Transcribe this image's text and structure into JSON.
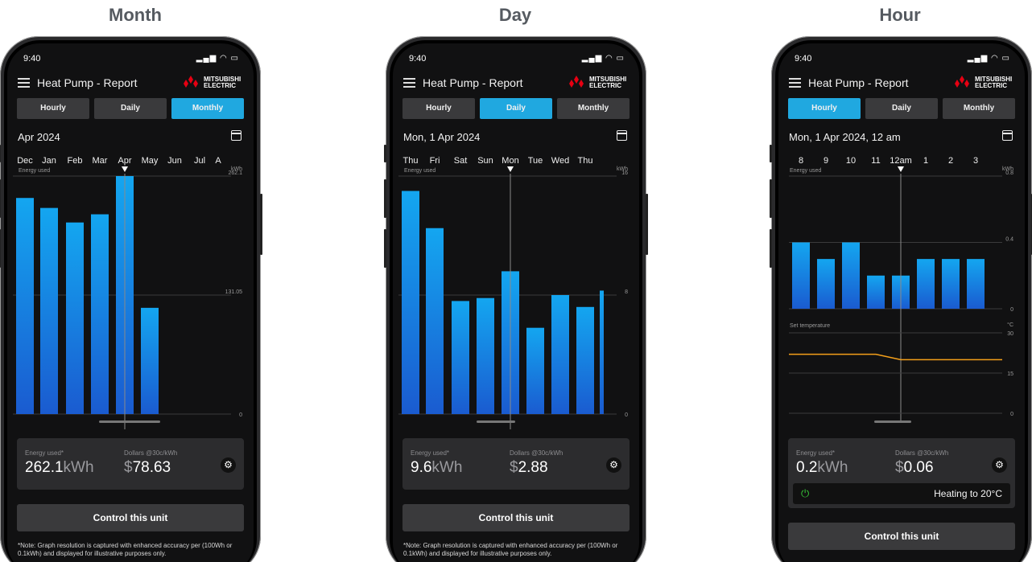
{
  "panels": [
    {
      "heading": "Month",
      "status_time": "9:40",
      "app_title": "Heat Pump - Report",
      "brand": "MITSUBISHI\nELECTRIC",
      "tabs": [
        "Hourly",
        "Daily",
        "Monthly"
      ],
      "active_tab": "Monthly",
      "date": "Apr 2024",
      "axis_labels": [
        "Dec",
        "Jan",
        "Feb",
        "Mar",
        "Apr",
        "May",
        "Jun",
        "Jul",
        "A"
      ],
      "chart_label": "Energy used",
      "chart_unit": "kWh",
      "summary": {
        "energy_label": "Energy used*",
        "energy_value": "262.1",
        "energy_unit": "kWh",
        "dollars_label": "Dollars @30c/kWh",
        "dollar_sign": "$",
        "dollars_value": "78.63"
      },
      "control_label": "Control this unit",
      "note": "*Note: Graph resolution is captured with enhanced accuracy per (100Wh or 0.1kWh) and displayed for illustrative purposes only."
    },
    {
      "heading": "Day",
      "status_time": "9:40",
      "app_title": "Heat Pump - Report",
      "brand": "MITSUBISHI\nELECTRIC",
      "tabs": [
        "Hourly",
        "Daily",
        "Monthly"
      ],
      "active_tab": "Daily",
      "date": "Mon, 1 Apr 2024",
      "axis_labels": [
        "Thu",
        "Fri",
        "Sat",
        "Sun",
        "Mon",
        "Tue",
        "Wed",
        "Thu"
      ],
      "chart_label": "Energy used",
      "chart_unit": "kWh",
      "summary": {
        "energy_label": "Energy used*",
        "energy_value": "9.6",
        "energy_unit": "kWh",
        "dollars_label": "Dollars @30c/kWh",
        "dollar_sign": "$",
        "dollars_value": "2.88"
      },
      "control_label": "Control this unit",
      "note": "*Note: Graph resolution is captured with enhanced accuracy per (100Wh or 0.1kWh) and displayed for illustrative purposes only."
    },
    {
      "heading": "Hour",
      "status_time": "9:40",
      "app_title": "Heat Pump - Report",
      "brand": "MITSUBISHI\nELECTRIC",
      "tabs": [
        "Hourly",
        "Daily",
        "Monthly"
      ],
      "active_tab": "Hourly",
      "date": "Mon, 1 Apr 2024, 12 am",
      "axis_labels": [
        "8",
        "9",
        "10",
        "11",
        "12am",
        "1",
        "2",
        "3"
      ],
      "chart_label": "Energy used",
      "chart_unit": "kWh",
      "temp_label": "Set temperature",
      "temp_unit": "°C",
      "summary": {
        "energy_label": "Energy used*",
        "energy_value": "0.2",
        "energy_unit": "kWh",
        "dollars_label": "Dollars @30c/kWh",
        "dollar_sign": "$",
        "dollars_value": "0.06"
      },
      "heating_text": "Heating to 20°C",
      "control_label": "Control this unit"
    }
  ],
  "chart_data": [
    {
      "type": "bar",
      "categories": [
        "Dec",
        "Jan",
        "Feb",
        "Mar",
        "Apr",
        "May",
        "Jun",
        "Jul"
      ],
      "values": [
        238,
        227,
        211,
        220,
        262.1,
        117,
        0,
        0
      ],
      "ylabel": "kWh",
      "ylim": [
        0,
        262.1
      ],
      "yticks": [
        0,
        131.05,
        262.1
      ],
      "selected": "Apr",
      "color": "#1aa0e8"
    },
    {
      "type": "bar",
      "categories": [
        "Thu",
        "Fri",
        "Sat",
        "Sun",
        "Mon",
        "Tue",
        "Wed",
        "Thu"
      ],
      "values": [
        15.0,
        12.5,
        7.6,
        7.8,
        9.6,
        5.8,
        8.0,
        7.2
      ],
      "ylabel": "kWh",
      "ylim": [
        0,
        16
      ],
      "yticks": [
        0,
        8,
        16
      ],
      "selected": "Mon",
      "color": "#1aa0e8"
    },
    {
      "type": "bar",
      "categories": [
        "8",
        "9",
        "10",
        "11",
        "12am",
        "1",
        "2",
        "3"
      ],
      "values": [
        0.4,
        0.3,
        0.4,
        0.2,
        0.2,
        0.3,
        0.3,
        0.3
      ],
      "ylabel": "kWh",
      "ylim": [
        0,
        0.8
      ],
      "yticks": [
        0,
        0.4,
        0.8
      ],
      "selected": "12am",
      "color": "#1aa0e8",
      "temperature": {
        "label": "Set temperature",
        "unit": "°C",
        "ylim": [
          0,
          30
        ],
        "yticks": [
          0,
          15,
          30
        ],
        "values": [
          22,
          22,
          22,
          22,
          20,
          20,
          20,
          20
        ],
        "color": "#f5a01a"
      }
    }
  ]
}
